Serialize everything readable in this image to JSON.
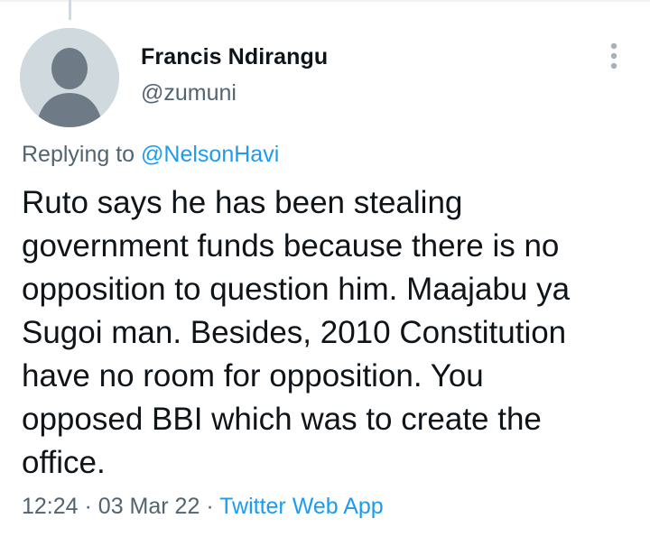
{
  "tweet": {
    "author": {
      "display_name": "Francis Ndirangu",
      "handle": "@zumuni",
      "avatar_icon": "default-avatar-icon"
    },
    "more_icon": "more-dots-vertical-icon",
    "replying_prefix": "Replying to",
    "replying_to": "@NelsonHavi",
    "text": "Ruto says he has been stealing\ngovernment funds because there is no\nopposition to question him. Maajabu ya\nSugoi man. Besides, 2010 Constitution\nhave no room for opposition. You\nopposed BBI which was to create the\noffice.",
    "time": "12:24",
    "date": "03 Mar 22",
    "separator": "·",
    "source": "Twitter Web App"
  },
  "colors": {
    "text_primary": "#0f1419",
    "text_secondary": "#536471",
    "link": "#1d9bf0",
    "avatar_bg": "#cfd9de",
    "avatar_fg": "#6e7a85"
  }
}
